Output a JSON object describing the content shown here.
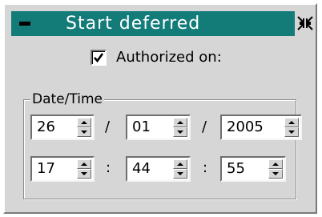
{
  "title": "Start deferred",
  "authorized": {
    "label": "Authorized  on:",
    "checked": true
  },
  "group_label": "Date/Time",
  "date": {
    "day": "26",
    "month": "01",
    "year": "2005",
    "separator": "/"
  },
  "time": {
    "hour": "17",
    "minute": "44",
    "second": "55",
    "separator": ":"
  }
}
